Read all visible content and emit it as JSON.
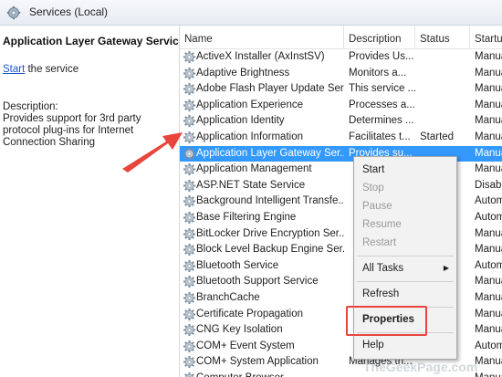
{
  "window": {
    "title": "Services (Local)"
  },
  "left_panel": {
    "service_name": "Application Layer Gateway Service",
    "start_link": "Start",
    "start_suffix": " the service",
    "description_label": "Description:",
    "description_text": "Provides support for 3rd party protocol plug-ins for Internet Connection Sharing"
  },
  "columns": {
    "name": "Name",
    "description": "Description",
    "status": "Status",
    "startup": "Startup"
  },
  "services": [
    {
      "name": "ActiveX Installer (AxInstSV)",
      "description": "Provides Us...",
      "status": "",
      "startup": "Manua"
    },
    {
      "name": "Adaptive Brightness",
      "description": "Monitors a...",
      "status": "",
      "startup": "Manua"
    },
    {
      "name": "Adobe Flash Player Update Ser...",
      "description": "This service ...",
      "status": "",
      "startup": "Manua"
    },
    {
      "name": "Application Experience",
      "description": "Processes a...",
      "status": "",
      "startup": "Manua"
    },
    {
      "name": "Application Identity",
      "description": "Determines ...",
      "status": "",
      "startup": "Manua"
    },
    {
      "name": "Application Information",
      "description": "Facilitates t...",
      "status": "Started",
      "startup": "Manua"
    },
    {
      "name": "Application Layer Gateway Ser...",
      "description": "Provides su...",
      "status": "",
      "startup": "Manua",
      "selected": true
    },
    {
      "name": "Application Management",
      "description": "",
      "status": "",
      "startup": "Manua"
    },
    {
      "name": "ASP.NET State Service",
      "description": "",
      "status": "",
      "startup": "Disable"
    },
    {
      "name": "Background Intelligent Transfe...",
      "description": "",
      "status": "",
      "startup": "Autom"
    },
    {
      "name": "Base Filtering Engine",
      "description": "",
      "status": "",
      "startup": "Autom"
    },
    {
      "name": "BitLocker Drive Encryption Ser...",
      "description": "",
      "status": "",
      "startup": "Manua"
    },
    {
      "name": "Block Level Backup Engine Ser...",
      "description": "",
      "status": "",
      "startup": "Manua"
    },
    {
      "name": "Bluetooth Service",
      "description": "",
      "status": "",
      "startup": "Autom"
    },
    {
      "name": "Bluetooth Support Service",
      "description": "",
      "status": "",
      "startup": "Manua"
    },
    {
      "name": "BranchCache",
      "description": "",
      "status": "",
      "startup": "Manua"
    },
    {
      "name": "Certificate Propagation",
      "description": "",
      "status": "",
      "startup": "Manua"
    },
    {
      "name": "CNG Key Isolation",
      "description": "",
      "status": "",
      "startup": "Manua"
    },
    {
      "name": "COM+ Event System",
      "description": "",
      "status": "",
      "startup": "Autom"
    },
    {
      "name": "COM+ System Application",
      "description": "Manages th...",
      "status": "",
      "startup": "Manua"
    },
    {
      "name": "Computer Browser",
      "description": "",
      "status": "",
      "startup": "Manua"
    }
  ],
  "context_menu": {
    "start": "Start",
    "stop": "Stop",
    "pause": "Pause",
    "resume": "Resume",
    "restart": "Restart",
    "all_tasks": "All Tasks",
    "refresh": "Refresh",
    "properties": "Properties",
    "help": "Help"
  },
  "watermark": "TheGeekPage.com",
  "colors": {
    "selection": "#3399ff",
    "link": "#1a56c8",
    "annotation": "#e8453c"
  },
  "icons": {
    "title": "services-gear-icon",
    "row": "service-gear-icon",
    "annotation": "red-arrow-icon"
  }
}
